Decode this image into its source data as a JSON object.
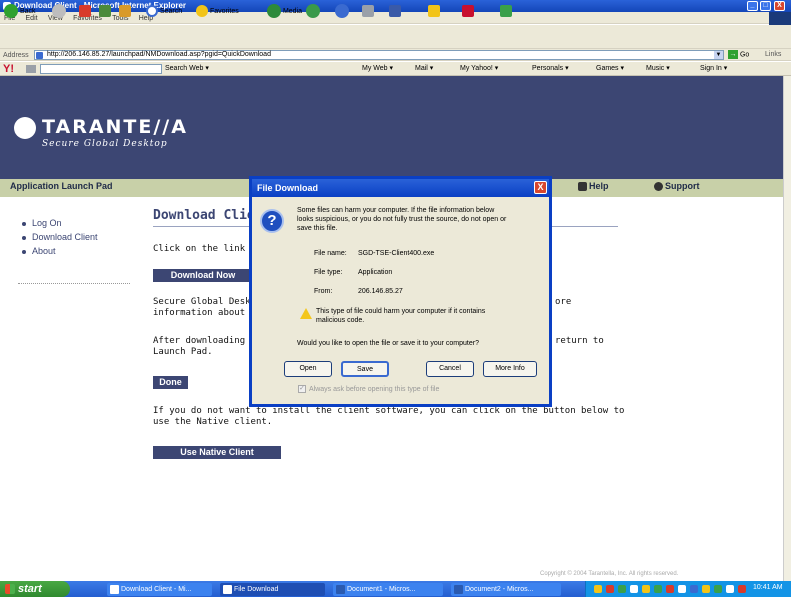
{
  "window": {
    "title": "Download Client - Microsoft Internet Explorer",
    "minimize_glyph": "_",
    "maximize_glyph": "□",
    "close_glyph": "X"
  },
  "menu": [
    "File",
    "Edit",
    "View",
    "Favorites",
    "Tools",
    "Help"
  ],
  "toolbar": {
    "back": "Back",
    "search": "Search",
    "favorites": "Favorites",
    "media": "Media"
  },
  "address": {
    "label": "Address",
    "url": "http://206.146.85.27/launchpad/NMDownload.asp?pgid=QuickDownload",
    "go": "Go",
    "links": "Links"
  },
  "yahoo": {
    "search_web": "Search Web",
    "my_web": "My Web",
    "mail": "Mail",
    "my_yahoo": "My Yahoo!",
    "personals": "Personals",
    "games": "Games",
    "music": "Music",
    "sign_in": "Sign In"
  },
  "page": {
    "logo": "TARANTE//A",
    "logo_sub": "Secure Global Desktop",
    "launch_title": "Application Launch Pad",
    "help": "Help",
    "support": "Support",
    "nav": [
      "Log On",
      "Download Client",
      "About"
    ],
    "heading": "Download Clie",
    "p1": "Click on the link be",
    "download_now": "Download Now",
    "p2_line1": "Secure Global Desk",
    "p2_line2": "information about t",
    "p2_right": "ore",
    "p3_line1": "After downloading",
    "p3_line2": "Launch Pad.",
    "p3_right": "return to",
    "done": "Done",
    "p4_line1": "If you do not want to install the client software, you can click on the button below to",
    "p4_line2": "use the Native client.",
    "native": "Use Native Client",
    "copyright": "Copyright © 2004 Tarantella, Inc. All rights reserved."
  },
  "dialog": {
    "title": "File Download",
    "message_l1": "Some files can harm your computer. If the file information below",
    "message_l2": "looks suspicious, or you do not fully trust the source, do not open or",
    "message_l3": "save this file.",
    "file_name_label": "File name:",
    "file_name": "SGD-TSE-Client400.exe",
    "file_type_label": "File type:",
    "file_type": "Application",
    "from_label": "From:",
    "from": "206.146.85.27",
    "warning_l1": "This type of file could harm your computer if it contains",
    "warning_l2": "malicious code.",
    "question": "Would you like to open the file or save it to your computer?",
    "open": "Open",
    "save": "Save",
    "cancel": "Cancel",
    "more_info": "More Info",
    "always_ask": "Always ask before opening this type of file",
    "question_glyph": "?",
    "close_glyph": "X"
  },
  "taskbar": {
    "start": "start",
    "tasks": [
      "Download Client - Mi...",
      "File Download",
      "Document1 - Micros...",
      "Document2 - Micros..."
    ],
    "clock": "10:41 AM"
  },
  "colors": {
    "banner": "#3c4673",
    "launchbar": "#c8d0a8",
    "dialog_border": "#0a3fc4",
    "taskbar": "#245ed0"
  }
}
